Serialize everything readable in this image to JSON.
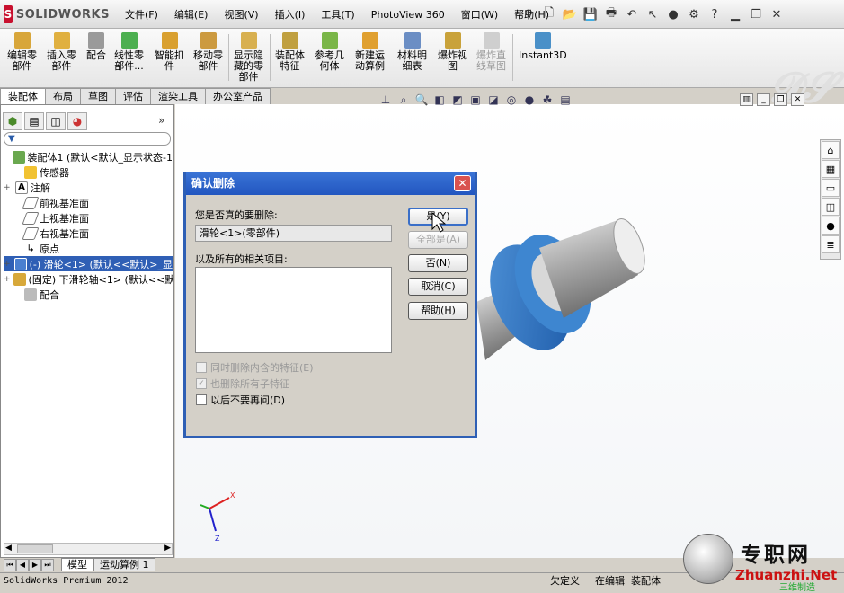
{
  "app": {
    "logo_text": "SOLIDWORKS",
    "logo_mark": "S"
  },
  "menu": [
    "文件(F)",
    "编辑(E)",
    "视图(V)",
    "插入(I)",
    "工具(T)",
    "PhotoView 360",
    "窗口(W)",
    "帮助(H)"
  ],
  "commands": [
    {
      "label": "编辑零\n部件",
      "enabled": true,
      "icon": "edit-component-icon"
    },
    {
      "label": "插入零\n部件",
      "enabled": true,
      "icon": "insert-component-icon"
    },
    {
      "label": "配合",
      "enabled": true,
      "icon": "mate-icon"
    },
    {
      "label": "线性零\n部件...",
      "enabled": true,
      "icon": "linear-pattern-icon"
    },
    {
      "label": "智能扣\n件",
      "enabled": true,
      "icon": "smart-fastener-icon"
    },
    {
      "label": "移动零\n部件",
      "enabled": true,
      "icon": "move-component-icon"
    },
    {
      "label": "显示隐\n藏的零\n部件",
      "enabled": true,
      "icon": "show-hidden-icon"
    },
    {
      "label": "装配体\n特征",
      "enabled": true,
      "icon": "assembly-feature-icon"
    },
    {
      "label": "参考几\n何体",
      "enabled": true,
      "icon": "reference-geometry-icon"
    },
    {
      "label": "新建运\n动算例",
      "enabled": true,
      "icon": "motion-study-icon"
    },
    {
      "label": "材料明\n细表",
      "enabled": true,
      "icon": "bom-icon"
    },
    {
      "label": "爆炸视\n图",
      "enabled": true,
      "icon": "exploded-view-icon"
    },
    {
      "label": "爆炸直\n线草图",
      "enabled": false,
      "icon": "explode-line-icon"
    },
    {
      "label": "Instant3D",
      "enabled": true,
      "icon": "instant3d-icon"
    }
  ],
  "cmd_tabs": [
    "装配体",
    "布局",
    "草图",
    "评估",
    "渲染工具",
    "办公室产品"
  ],
  "tree": {
    "filter": "▼",
    "items": [
      {
        "label": "装配体1  (默认<默认_显示状态-1",
        "expand": "",
        "selected": false
      },
      {
        "label": "传感器",
        "expand": "",
        "selected": false
      },
      {
        "label": "注解",
        "expand": "+",
        "selected": false
      },
      {
        "label": "前视基准面",
        "expand": "",
        "selected": false
      },
      {
        "label": "上视基准面",
        "expand": "",
        "selected": false
      },
      {
        "label": "右视基准面",
        "expand": "",
        "selected": false
      },
      {
        "label": "原点",
        "expand": "",
        "selected": false
      },
      {
        "label": "(-) 滑轮<1> (默认<<默认>_显",
        "expand": "+",
        "selected": true
      },
      {
        "label": "(固定) 下滑轮轴<1> (默认<<默",
        "expand": "+",
        "selected": false
      },
      {
        "label": "配合",
        "expand": "",
        "selected": false
      }
    ]
  },
  "bottom_tabs": [
    "模型",
    "运动算例 1"
  ],
  "status": {
    "left": "SolidWorks Premium 2012",
    "a": "欠定义",
    "b": "在编辑",
    "c": "装配体"
  },
  "dialog": {
    "title": "确认删除",
    "prompt": "您是否真的要删除:",
    "item": "滑轮<1>(零部件)",
    "related_label": "以及所有的相关项目:",
    "buttons": {
      "yes": "是(Y)",
      "yes_all": "全部是(A)",
      "no": "否(N)",
      "cancel": "取消(C)",
      "help": "帮助(H)"
    },
    "checks": {
      "delete_features": "同时删除内含的特征(E)",
      "delete_children": "也删除所有子特征",
      "dont_ask": "以后不要再问(D)"
    }
  },
  "watermark": {
    "cn": "专职网",
    "url": "Zhuanzhi.Net",
    "sub": "三维制造"
  },
  "colors": {
    "title_blue": "#2256c0",
    "selection": "#2f5fb5",
    "part_blue": "#2f76c9"
  }
}
